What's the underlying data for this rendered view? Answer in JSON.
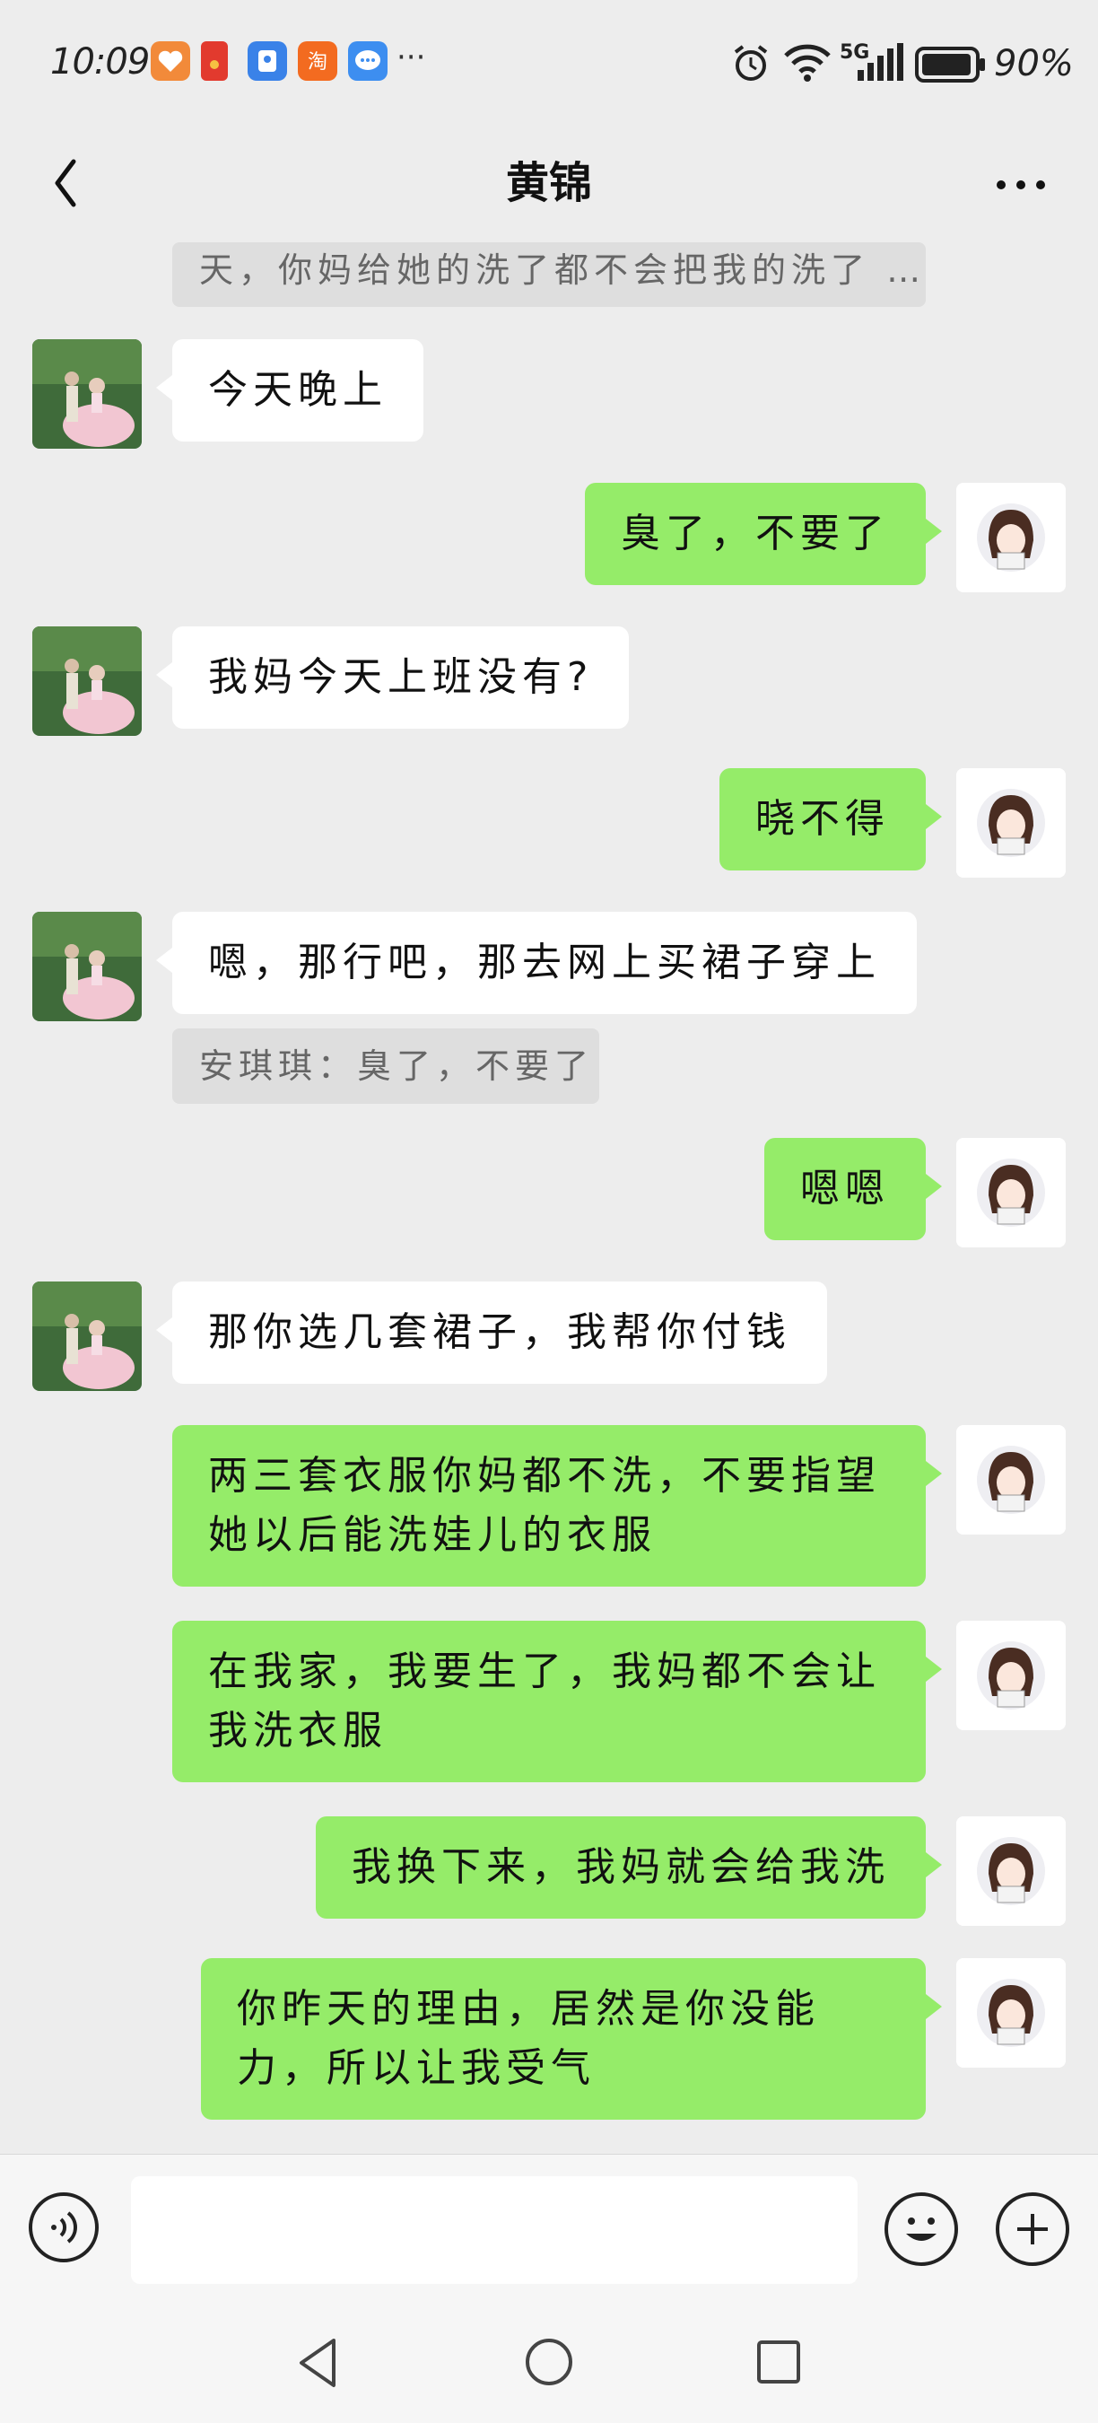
{
  "status_bar": {
    "time": "10:09",
    "network": "5G",
    "battery": "90%",
    "more_glyph": "···"
  },
  "header": {
    "title": "黄锦"
  },
  "chat": {
    "top_quote": "天，你妈给她的洗了都不会把我的洗了 …",
    "messages": [
      {
        "side": "left",
        "text": "今天晚上"
      },
      {
        "side": "right",
        "text": "臭了，不要了"
      },
      {
        "side": "left",
        "text": "我妈今天上班没有?"
      },
      {
        "side": "right",
        "text": "晓不得"
      },
      {
        "side": "left",
        "text": "嗯，那行吧，那去网上买裙子穿上"
      },
      {
        "side": "right",
        "text": "嗯嗯"
      },
      {
        "side": "left",
        "text": "那你选几套裙子，我帮你付钱"
      },
      {
        "side": "right",
        "text": "两三套衣服你妈都不洗，不要指望她以后能洗娃儿的衣服"
      },
      {
        "side": "right",
        "text": "在我家，我要生了，我妈都不会让我洗衣服"
      },
      {
        "side": "right",
        "text": "我换下来，我妈就会给我洗"
      },
      {
        "side": "right",
        "text": "你昨天的理由，居然是你没能力，所以让我受气"
      }
    ],
    "reply_quote": "安琪琪：臭了，不要了"
  },
  "colors": {
    "background": "#ededed",
    "sent_bubble": "#95ec69",
    "received_bubble": "#ffffff"
  }
}
